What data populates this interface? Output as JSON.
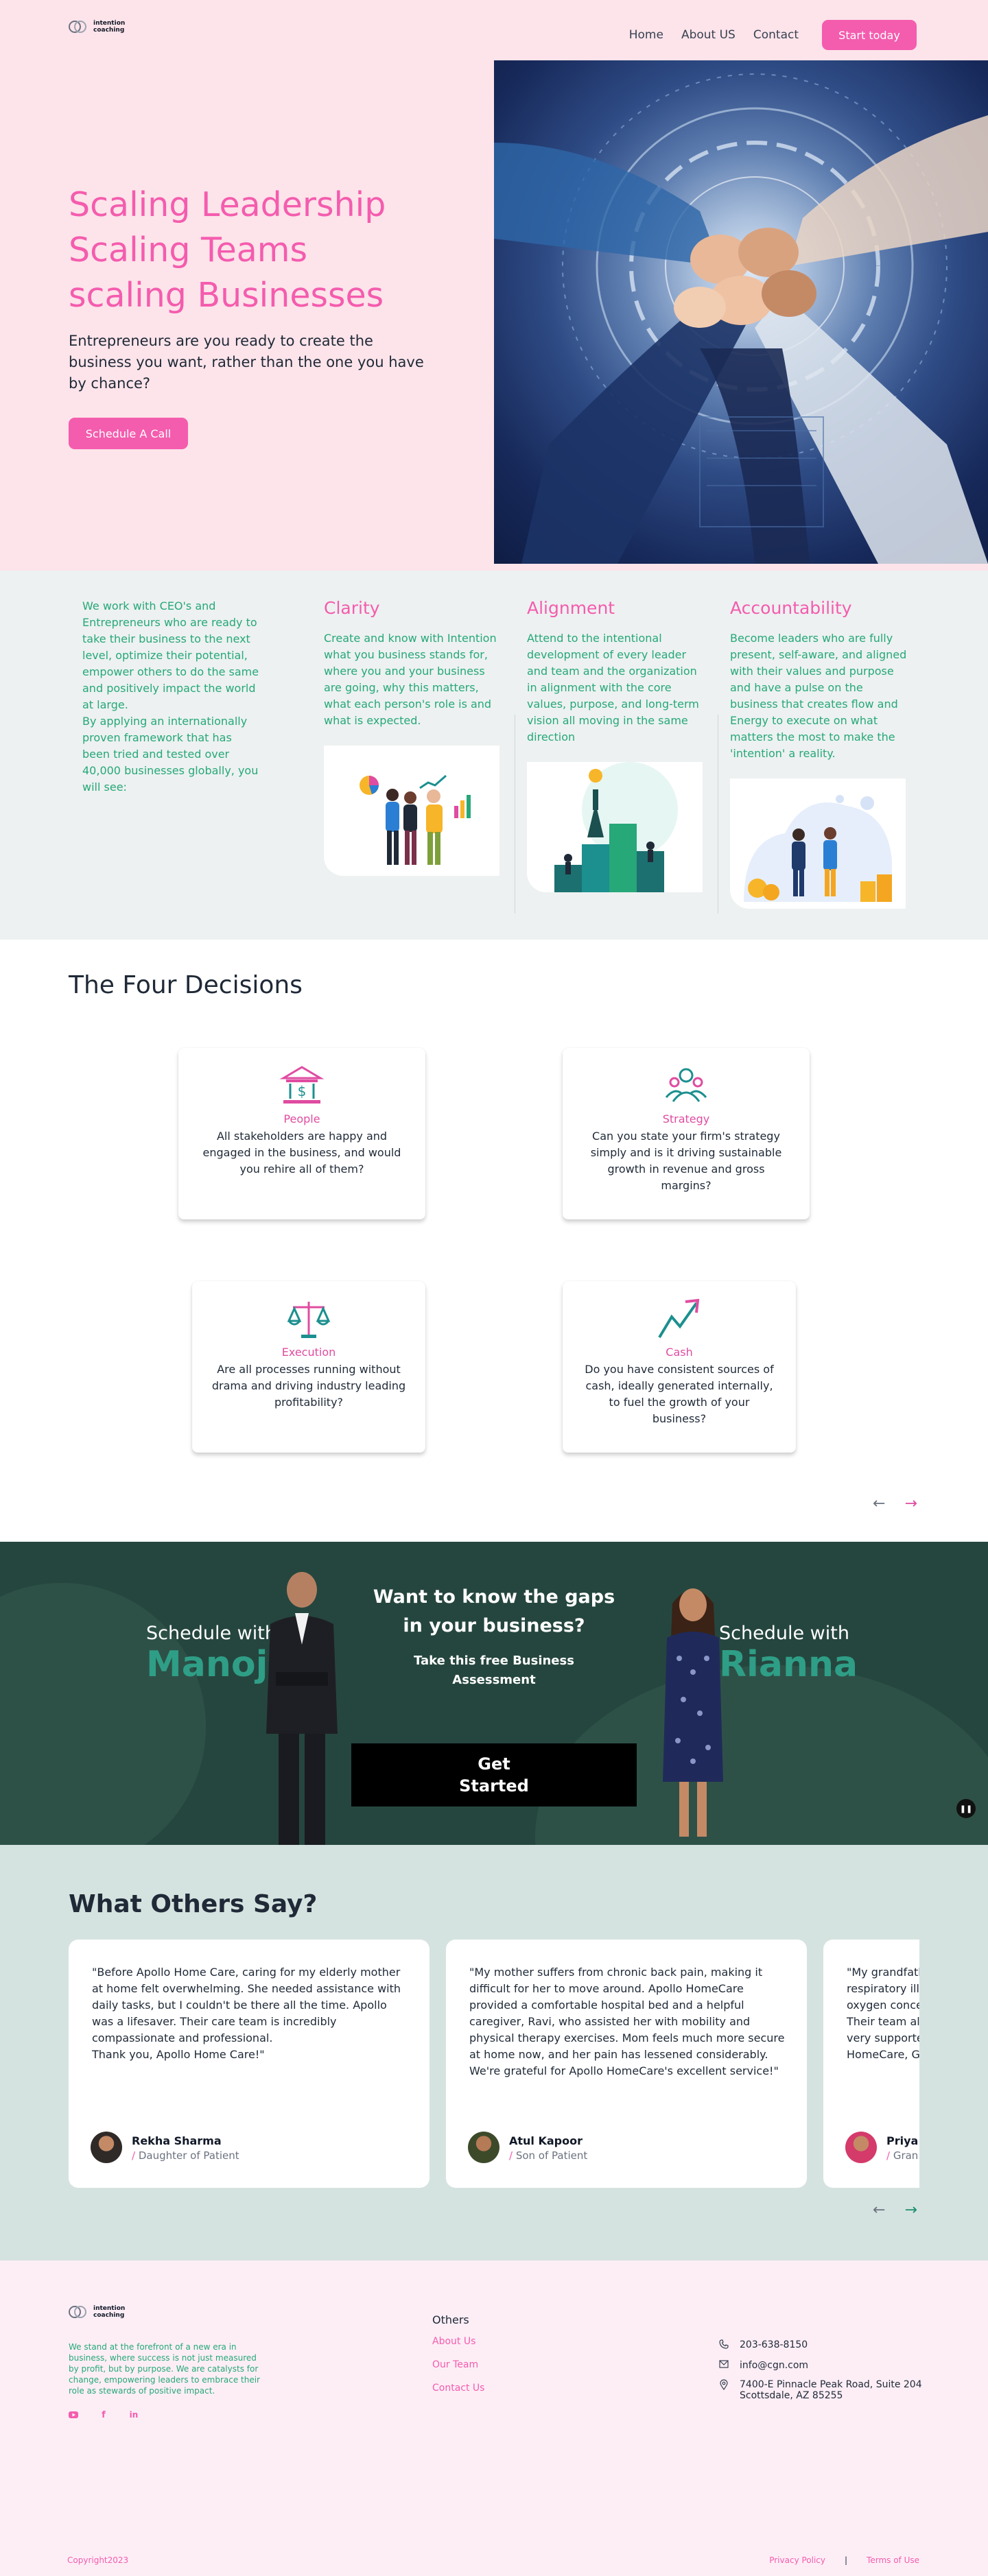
{
  "nav": {
    "logo_text_1": "intention",
    "logo_text_2": "coaching",
    "links": [
      "Home",
      "About US",
      "Contact"
    ],
    "cta": "Start today"
  },
  "hero": {
    "title_1": "Scaling Leadership",
    "title_2": "Scaling Teams",
    "title_3": "scaling Businesses",
    "subtitle": "Entrepreneurs are you ready to create the business you want, rather than the one you have by chance?",
    "button": "Schedule A Call"
  },
  "values": {
    "intro_1": "We work with CEO's and Entrepreneurs who are ready to take their business to the next level, optimize their potential, empower others to do the same and positively impact the world at large.",
    "intro_2": "By applying an internationally proven framework that has been tried and tested over 40,000 businesses globally, you will see:",
    "columns": [
      {
        "title": "Clarity",
        "text": "Create and know with Intention what you business stands for, where you and your business are going, why this matters, what each person's role is and what is expected."
      },
      {
        "title": "Alignment",
        "text": "Attend to the intentional development of every leader and team and the organization in alignment with the core values, purpose, and long-term vision all moving in the same direction"
      },
      {
        "title": "Accountability",
        "text": "Become leaders who are fully present, self-aware, and aligned with their values and purpose and have a pulse on the business that creates flow and Energy to execute on what matters the most to make the 'intention' a reality."
      }
    ]
  },
  "decisions": {
    "title": "The Four Decisions",
    "cards": [
      {
        "label": "People",
        "text": "All stakeholders are happy and engaged in the business, and would you rehire all of them?"
      },
      {
        "label": "Strategy",
        "text": "Can you state your firm's strategy simply and is it driving sustainable growth in revenue and gross margins?"
      },
      {
        "label": "Execution",
        "text": "Are all processes running without drama and driving industry leading profitability?"
      },
      {
        "label": "Cash",
        "text": "Do you have consistent sources of cash, ideally generated internally, to fuel the growth of your business?"
      }
    ],
    "prev": "←",
    "next": "→"
  },
  "cta": {
    "schedule_with": "Schedule with",
    "left_name": "Manoj",
    "right_name": "Rianna",
    "headline_1": "Want to know the gaps",
    "headline_2": "in your business?",
    "sub_1": "Take this free Business",
    "sub_2": "Assessment",
    "button_1": "Get",
    "button_2": "Started",
    "pause": "❚❚"
  },
  "testimonials": {
    "title": "What Others Say?",
    "items": [
      {
        "quote": "\"Before Apollo Home Care, caring for my elderly mother at home felt overwhelming.  She needed assistance with daily tasks, but I couldn't be there all the time.  Apollo was a lifesaver.  Their care team is incredibly compassionate and professional.\nThank you, Apollo Home Care!\"",
        "name": "Rekha Sharma",
        "role": "Daughter of Patient"
      },
      {
        "quote": "\"My mother suffers from chronic back pain, making it difficult for her to move around. Apollo HomeCare provided a comfortable hospital bed and a helpful caregiver, Ravi, who assisted her with mobility and physical therapy exercises. Mom feels much more secure at home now, and her pain has lessened considerably. We're grateful for Apollo HomeCare's excellent service!\"",
        "name": "Atul Kapoor",
        "role": "Son of Patient"
      },
      {
        "quote": "\"My grandfath\nrespiratory illn\noxygen conce\nTheir team als\nvery supporte\nHomeCare, G",
        "name": "Priya R",
        "role": "Gran"
      }
    ],
    "prev": "←",
    "next": "→"
  },
  "footer": {
    "logo_text_1": "intention",
    "logo_text_2": "coaching",
    "about": "We stand at the forefront of a new era in business, where success is not just measured by profit, but by purpose. We are catalysts for change, empowering leaders to embrace their role as stewards of positive impact.",
    "others_title": "Others",
    "others_links": [
      "About Us",
      "Our Team",
      "Contact Us"
    ],
    "phone": "203-638-8150",
    "email": "info@cgn.com",
    "address_1": "7400-E Pinnacle Peak Road, Suite 204",
    "address_2": "Scottsdale, AZ 85255",
    "copyright": "Copyright2023",
    "privacy": "Privacy Policy",
    "separator": "|",
    "terms": "Terms of Use"
  },
  "colors": {
    "pink": "#f45cae",
    "hero_bg": "#fde4ea",
    "green_text": "#26a878",
    "cta_bg": "#25463e",
    "testimonial_bg": "#d5e3e0",
    "footer_bg": "#fdeef6"
  }
}
